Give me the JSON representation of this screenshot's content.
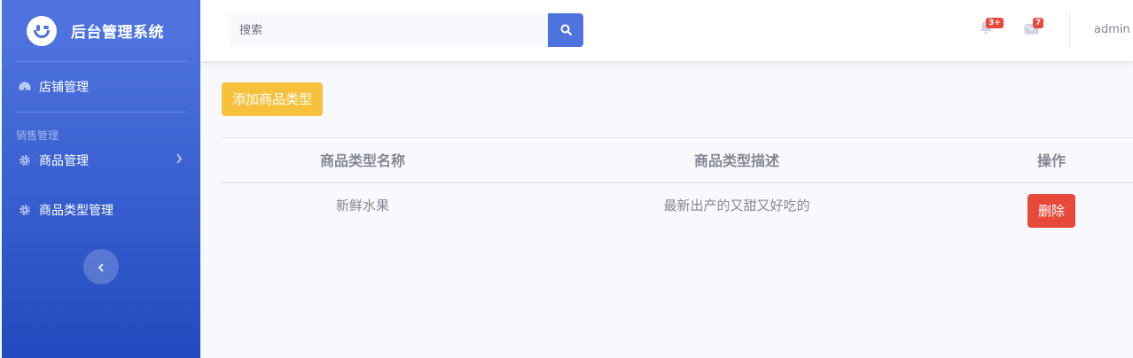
{
  "sidebar": {
    "brand": "后台管理系统",
    "items": [
      {
        "label": "店铺管理",
        "icon": "tachometer-icon"
      },
      {
        "label": "商品管理",
        "icon": "gear-icon"
      },
      {
        "label": "商品类型管理",
        "icon": "gear-icon"
      }
    ],
    "section_heading": "销售管理"
  },
  "topbar": {
    "search_placeholder": "搜索",
    "alerts_badge": "3+",
    "messages_badge": "7",
    "username": "admin"
  },
  "main": {
    "add_button": "添加商品类型",
    "table": {
      "headers": [
        "商品类型名称",
        "商品类型描述",
        "操作"
      ],
      "rows": [
        {
          "name": "新鲜水果",
          "description": "最新出产的又甜又好吃的",
          "action": "删除"
        }
      ]
    }
  },
  "colors": {
    "sidebar_primary": "#4e73df",
    "warning": "#f6c23e",
    "danger": "#e74a3b",
    "text_muted": "#858796"
  }
}
